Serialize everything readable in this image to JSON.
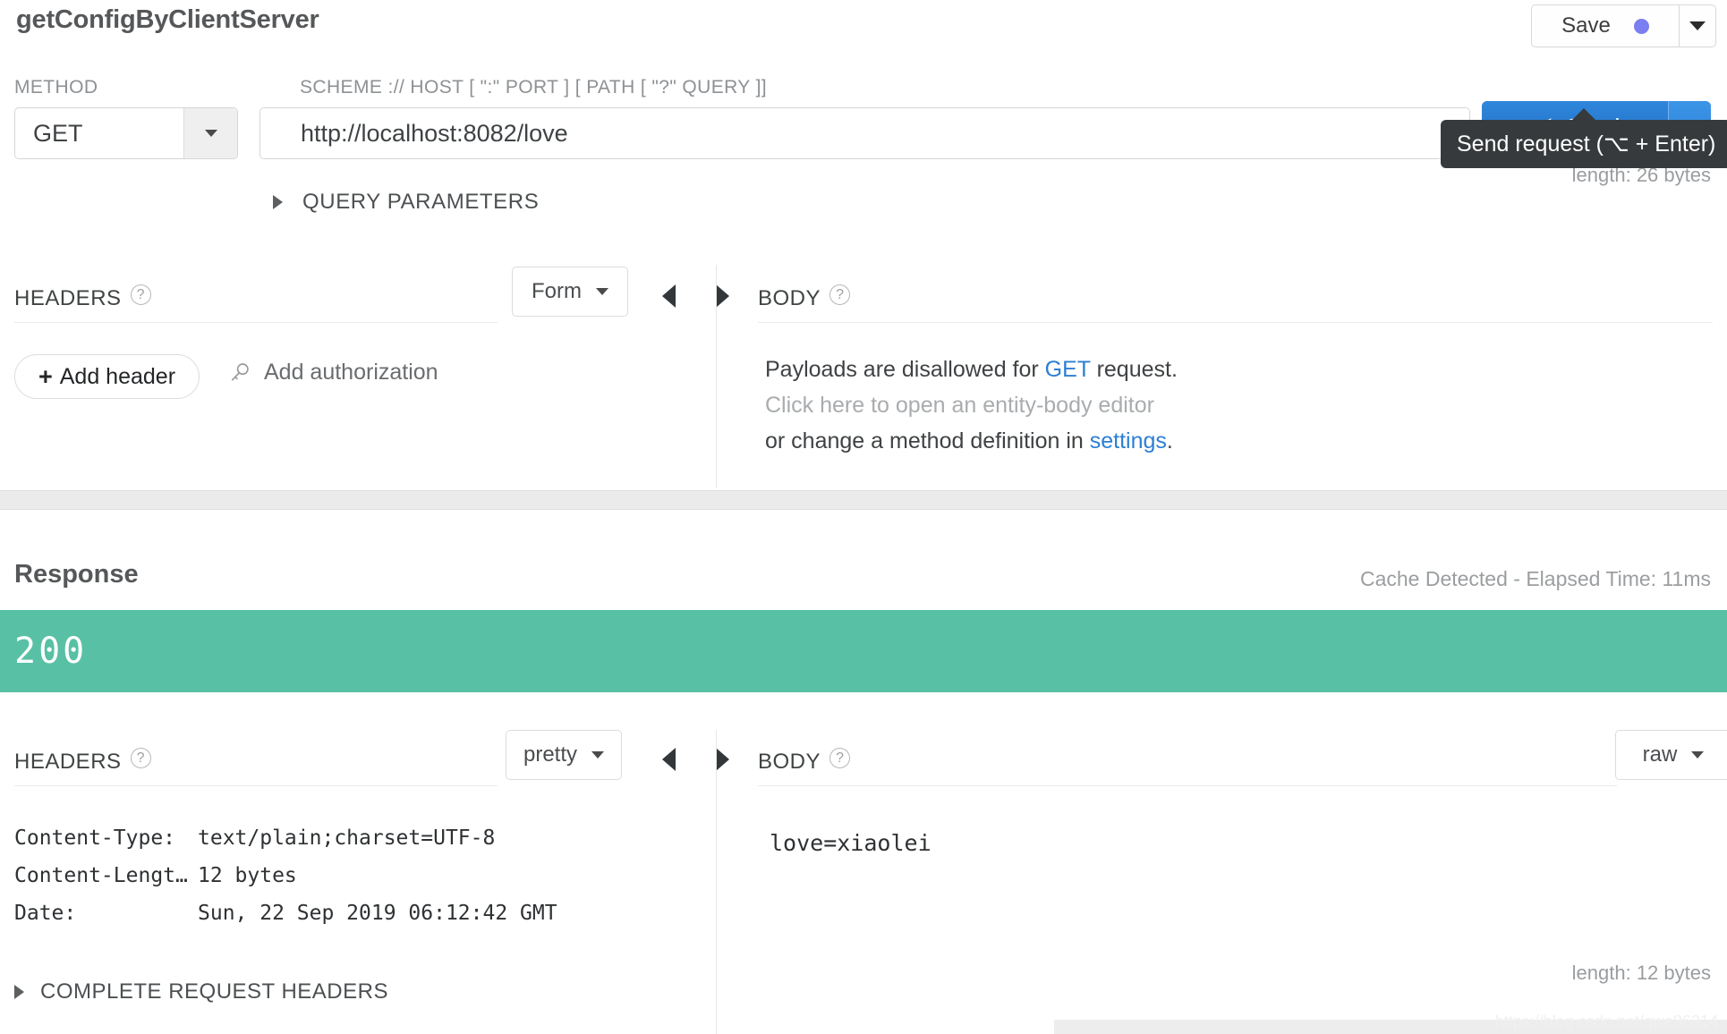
{
  "request": {
    "title": "getConfigByClientServer",
    "save_label": "Save",
    "save_dot_color": "#7b7ef0",
    "method_label": "METHOD",
    "method_value": "GET",
    "url_label": "SCHEME :// HOST [ \":\" PORT ] [ PATH [ \"?\" QUERY ]]",
    "url_value": "http://localhost:8082/love",
    "send_label": "Send",
    "send_tooltip": "Send request (⌥ + Enter)",
    "length_text": "length: 26 bytes",
    "query_parameters_label": "QUERY PARAMETERS",
    "headers_label": "HEADERS",
    "headers_format": "Form",
    "body_label": "BODY",
    "add_header_label": "Add header",
    "add_header_plus": "+",
    "add_authorization_label": "Add authorization",
    "body_msg_1_pre": "Payloads are disallowed for ",
    "body_msg_1_link": "GET",
    "body_msg_1_post": " request.",
    "body_msg_2": "Click here to open an entity-body editor",
    "body_msg_3_pre": "or change a method definition in ",
    "body_msg_3_link": "settings",
    "body_msg_3_post": ".",
    "help_glyph": "?"
  },
  "response": {
    "title": "Response",
    "meta": "Cache Detected - Elapsed Time: 11ms",
    "status_code": "200",
    "status_color": "#58c0a5",
    "headers_label": "HEADERS",
    "headers_format": "pretty",
    "body_label": "BODY",
    "body_format": "raw",
    "headers": [
      {
        "key": "Content-Type:",
        "value": "text/plain;charset=UTF-8"
      },
      {
        "key": "Content-Lengt…",
        "value": "12 bytes"
      },
      {
        "key": "Date:",
        "value": "Sun, 22 Sep 2019 06:12:42 GMT"
      }
    ],
    "complete_request_headers_label": "COMPLETE REQUEST HEADERS",
    "body_text": "love=xiaolei",
    "length_text": "length: 12 bytes",
    "help_glyph": "?"
  },
  "watermark": "https://blog.csdn.net/qwe86314"
}
